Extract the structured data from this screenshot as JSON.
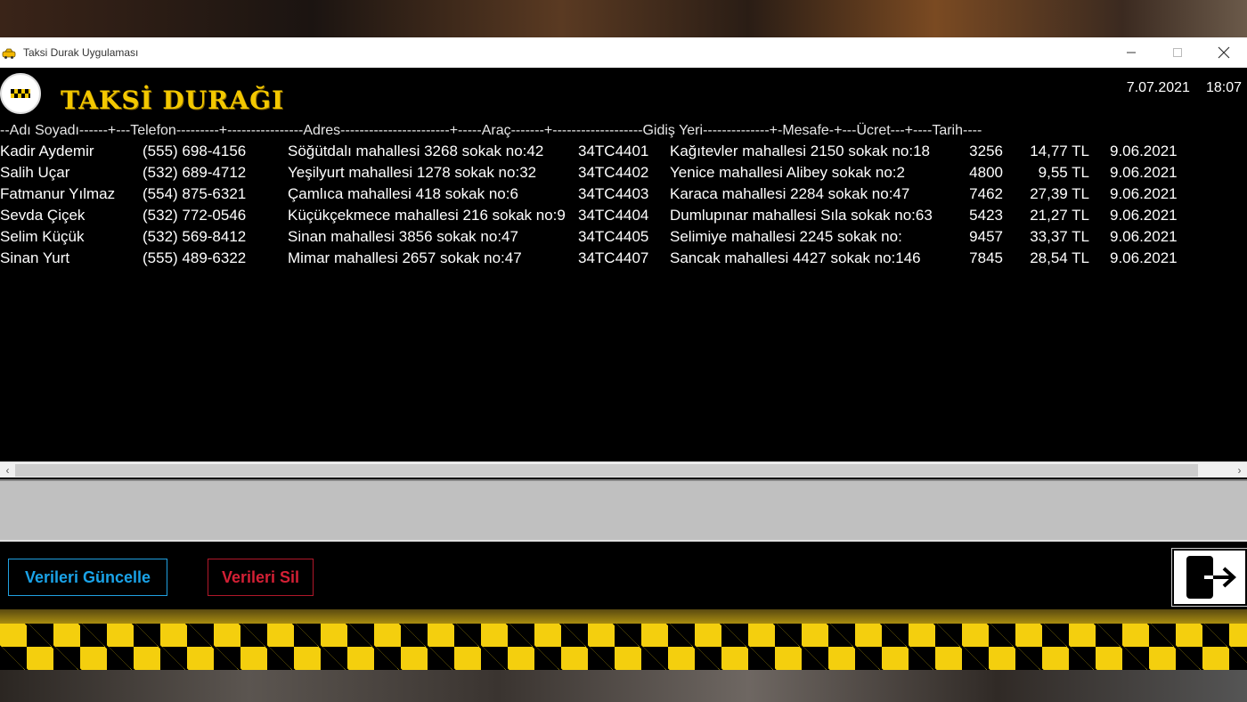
{
  "window": {
    "title": "Taksi Durak Uygulaması"
  },
  "header": {
    "brand": "TAKSİ DURAĞI",
    "date": "7.07.2021",
    "time": "18:07"
  },
  "table": {
    "header_line": "--Adı Soyadı------+---Telefon---------+----------------Adres-----------------------+-----Araç-------+-------------------Gidiş Yeri--------------+-Mesafe-+---Ücret---+----Tarih----",
    "rows": [
      {
        "name": "Kadir Aydemir",
        "phone": "(555) 698-4156",
        "address": "Söğütdalı mahallesi 3268 sokak no:42",
        "vehicle": "34TC4401",
        "destination": "Kağıtevler mahallesi 2150 sokak no:18",
        "distance": "3256",
        "fare": "14,77 TL",
        "date": "9.06.2021"
      },
      {
        "name": "Salih Uçar",
        "phone": "(532) 689-4712",
        "address": "Yeşilyurt mahallesi 1278 sokak no:32",
        "vehicle": "34TC4402",
        "destination": "Yenice mahallesi Alibey sokak no:2",
        "distance": "4800",
        "fare": "9,55 TL",
        "date": "9.06.2021"
      },
      {
        "name": "Fatmanur Yılmaz",
        "phone": "(554) 875-6321",
        "address": "Çamlıca mahallesi 418 sokak no:6",
        "vehicle": "34TC4403",
        "destination": "Karaca mahallesi 2284 sokak no:47",
        "distance": "7462",
        "fare": "27,39 TL",
        "date": "9.06.2021"
      },
      {
        "name": "Sevda Çiçek",
        "phone": "(532) 772-0546",
        "address": "Küçükçekmece mahallesi 216 sokak no:9",
        "vehicle": "34TC4404",
        "destination": "Dumlupınar mahallesi Sıla sokak no:63",
        "distance": "5423",
        "fare": "21,27 TL",
        "date": "9.06.2021"
      },
      {
        "name": "Selim Küçük",
        "phone": "(532) 569-8412",
        "address": "Sinan mahallesi 3856 sokak no:47",
        "vehicle": "34TC4405",
        "destination": "Selimiye mahallesi 2245 sokak no:",
        "distance": "9457",
        "fare": "33,37 TL",
        "date": "9.06.2021"
      },
      {
        "name": "Sinan Yurt",
        "phone": "(555) 489-6322",
        "address": "Mimar mahallesi 2657 sokak no:47",
        "vehicle": "34TC4407",
        "destination": "Sancak mahallesi 4427 sokak no:146",
        "distance": "7845",
        "fare": "28,54 TL",
        "date": "9.06.2021"
      }
    ]
  },
  "buttons": {
    "update": "Verileri Güncelle",
    "delete": "Verileri Sil"
  },
  "icons": {
    "app": "taxi-icon",
    "logo": "taxi-logo-icon",
    "exit": "exit-door-icon"
  },
  "colors": {
    "brand": "#f3c800",
    "update_button": "#1aa3e8",
    "delete_button": "#d42035",
    "ghost_text": "#c8001e"
  }
}
